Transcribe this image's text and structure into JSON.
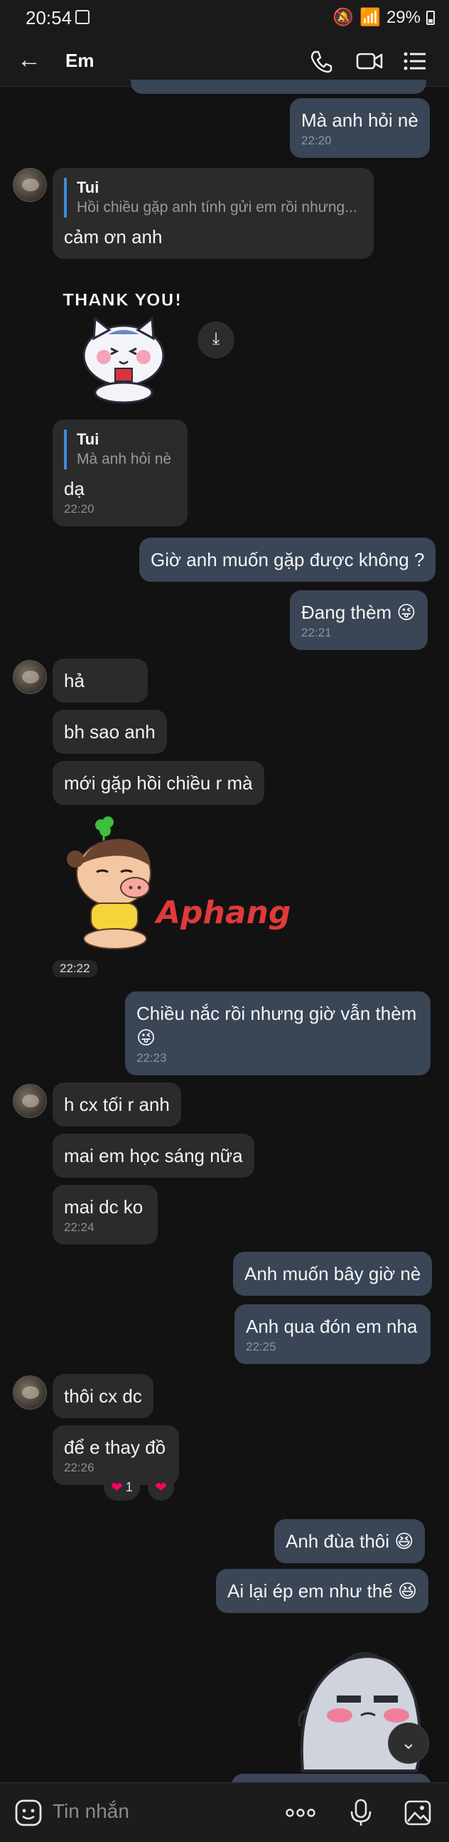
{
  "status": {
    "time": "20:54",
    "battery": "29%"
  },
  "header": {
    "title": "Em"
  },
  "messages": {
    "m1": {
      "text": "Mà anh hỏi nè",
      "time": "22:20"
    },
    "m2": {
      "quote_name": "Tui",
      "quote_text": "Hồi chiều gặp anh tính gửi em rồi nhưng...",
      "text": "cảm ơn anh"
    },
    "sticker1": {
      "text": "THANK YOU!"
    },
    "m3": {
      "quote_name": "Tui",
      "quote_text": "Mà anh hỏi nè",
      "text": "dạ",
      "time": "22:20"
    },
    "m4": {
      "text": "Giờ anh muốn gặp được không ?"
    },
    "m5": {
      "text": "Đang thèm",
      "time": "22:21"
    },
    "m6": {
      "text": "hả"
    },
    "m7": {
      "text": "bh sao anh"
    },
    "m8": {
      "text": "mới gặp hồi chiều r mà"
    },
    "sticker2": {
      "watermark": "Aphang",
      "time": "22:22"
    },
    "m9": {
      "text": "Chiều nắc rồi nhưng giờ vẫn thèm",
      "time": "22:23"
    },
    "m10": {
      "text": "h cx tối r anh"
    },
    "m11": {
      "text": "mai em học sáng nữa"
    },
    "m12": {
      "text": "mai dc ko",
      "time": "22:24"
    },
    "m13": {
      "text": "Anh muốn bây giờ nè"
    },
    "m14": {
      "text": "Anh qua đón em nha",
      "time": "22:25"
    },
    "m15": {
      "text": "thôi cx dc"
    },
    "m16": {
      "text": "để e thay đồ",
      "time": "22:26"
    },
    "m16_reactions": {
      "count": "1"
    },
    "m17": {
      "text": "Anh đùa thôi"
    },
    "m18": {
      "text": "Ai lại ép em như thế"
    }
  },
  "composer": {
    "placeholder": "Tin nhắn"
  },
  "colors": {
    "accent": "#3d8bd9",
    "outgoing": "#3a4556",
    "incoming": "#2b2b2b",
    "background": "#121212"
  }
}
